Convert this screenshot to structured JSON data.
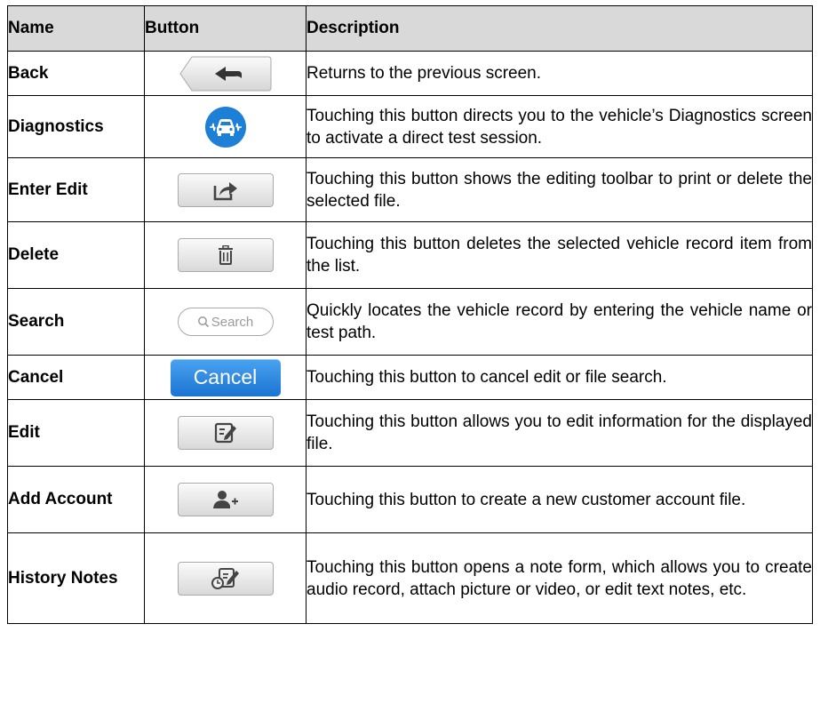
{
  "headers": {
    "name": "Name",
    "button": "Button",
    "description": "Description"
  },
  "rows": [
    {
      "name": "Back",
      "icon": "back-arrow-icon",
      "description": "Returns to the previous screen."
    },
    {
      "name": "Diagnostics",
      "icon": "car-diagnostics-icon",
      "description": "Touching this button directs you to the vehicle’s Diagnostics screen to activate a direct test session."
    },
    {
      "name": "Enter Edit",
      "icon": "share-export-icon",
      "description": "Touching this button shows the editing toolbar to print or delete the selected file."
    },
    {
      "name": "Delete",
      "icon": "trash-icon",
      "description": "Touching this button deletes the selected vehicle record item from the list."
    },
    {
      "name": "Search",
      "icon": "search-icon",
      "button_text": "Search",
      "description": "Quickly locates the vehicle record by entering the vehicle name or test path."
    },
    {
      "name": "Cancel",
      "button_text": "Cancel",
      "description": "Touching this button to cancel edit or file search."
    },
    {
      "name": "Edit",
      "icon": "edit-note-icon",
      "description": "Touching this button allows you to edit information for the displayed file."
    },
    {
      "name": "Add Account",
      "icon": "add-user-icon",
      "description": "Touching this button to create a new customer account file."
    },
    {
      "name": "History Notes",
      "icon": "history-notes-icon",
      "description": "Touching this button opens a note form, which allows you to create audio record, attach picture or video, or edit text notes, etc."
    }
  ],
  "colors": {
    "header_bg": "#d9d9d9",
    "cancel_blue": "#1a73d1",
    "diagnostics_blue": "#1e7fd6"
  }
}
